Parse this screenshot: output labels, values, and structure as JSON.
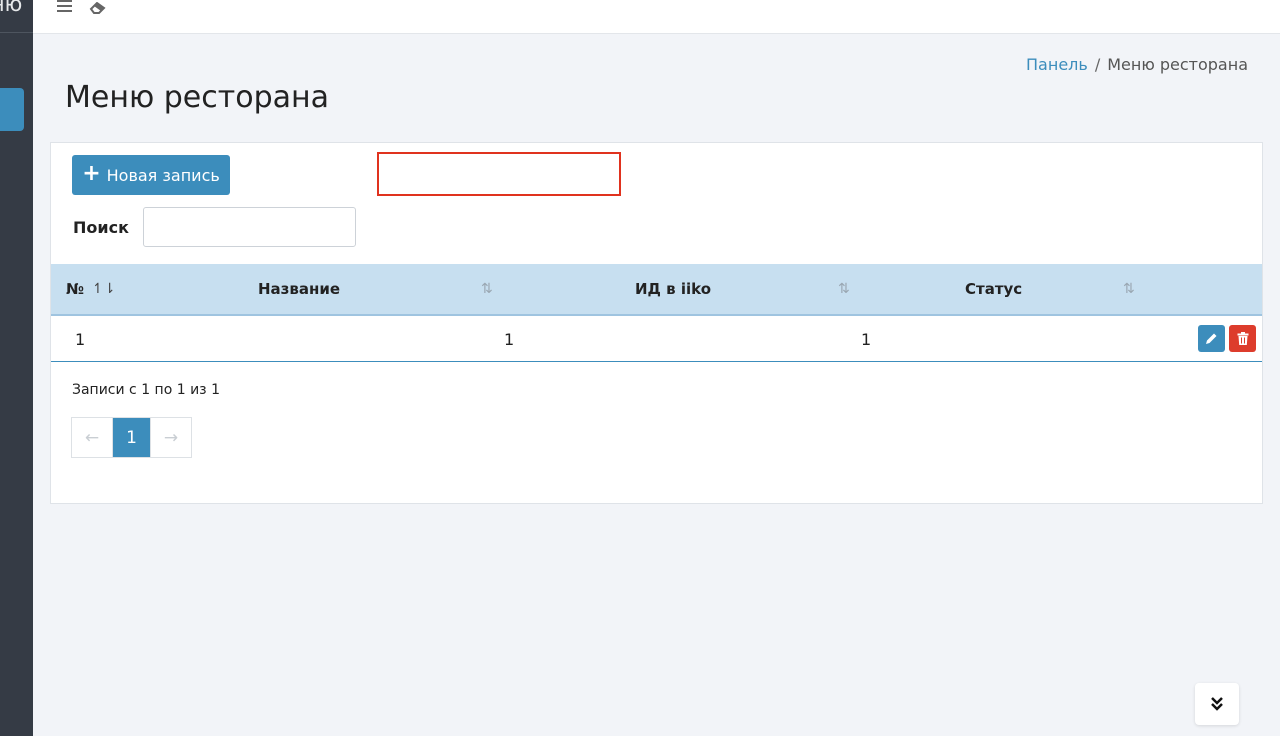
{
  "sidebar": {
    "brand_text": "еню"
  },
  "topbar": {
    "menu_icon": "hamburger-icon",
    "eraser_icon": "eraser-icon"
  },
  "breadcrumb": {
    "home": "Панель",
    "separator": "/",
    "current": "Меню ресторана"
  },
  "page": {
    "title": "Меню ресторана"
  },
  "toolbar": {
    "new_record_label": "Новая запись",
    "new_record_icon": "plus-icon",
    "search_label": "Поиск",
    "search_value": ""
  },
  "table": {
    "columns": [
      {
        "label": "№",
        "sort_icon": "sort-asc-icon"
      },
      {
        "label": "Название",
        "sort_icon": "sort-icon"
      },
      {
        "label": "ИД в iiko",
        "sort_icon": "sort-icon"
      },
      {
        "label": "Статус",
        "sort_icon": "sort-icon"
      }
    ],
    "rows": [
      {
        "num": "1",
        "name": "1",
        "iiko_id": "1",
        "status": ""
      }
    ]
  },
  "footer": {
    "records_info": "Записи с 1 по 1 из 1",
    "pagination": {
      "prev": "←",
      "current": "1",
      "next": "→"
    }
  },
  "colors": {
    "primary": "#3c8dbc",
    "danger": "#dd3c2c",
    "sidebar_bg": "#353b45",
    "table_header_bg": "#c7dff0",
    "highlight_box": "#e0321e"
  }
}
